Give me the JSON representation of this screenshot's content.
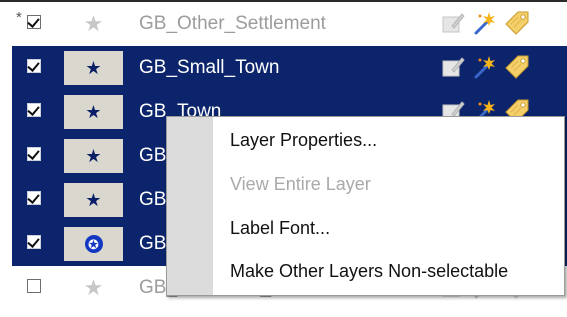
{
  "layers": [
    {
      "name": "GB_Other_Settlement",
      "checked": true,
      "selected": false,
      "asterisk": "*",
      "symbol": "star-gray-icon"
    },
    {
      "name": "GB_Small_Town",
      "checked": true,
      "selected": true,
      "asterisk": "",
      "symbol": "star-navy-icon"
    },
    {
      "name": "GB_Town",
      "checked": true,
      "selected": true,
      "asterisk": "",
      "symbol": "star-navy-icon"
    },
    {
      "name": "GB",
      "checked": true,
      "selected": true,
      "asterisk": "",
      "symbol": "star-navy-icon"
    },
    {
      "name": "GB",
      "checked": true,
      "selected": true,
      "asterisk": "",
      "symbol": "star-navy-icon"
    },
    {
      "name": "GB",
      "checked": true,
      "selected": true,
      "asterisk": "",
      "symbol": "star-badge-icon"
    },
    {
      "name": "GB_Gazetteer_Full",
      "checked": false,
      "selected": false,
      "asterisk": "",
      "symbol": "star-gray-icon"
    }
  ],
  "row_actions": [
    "edit-icon",
    "wand-icon",
    "tag-icon"
  ],
  "context_menu": {
    "items": [
      {
        "label": "Layer Properties...",
        "enabled": true
      },
      {
        "label": "View Entire Layer",
        "enabled": false
      },
      {
        "label": "Label Font...",
        "enabled": true
      },
      {
        "label": "Make Other Layers Non-selectable",
        "enabled": true
      }
    ]
  },
  "colors": {
    "selection": "#0b246b",
    "menu_gutter": "#dcdcdc",
    "disabled_text": "#a9a9a9",
    "star_navy": "#0a1f66",
    "star_gray": "#c8c8c8",
    "badge_blue": "#1437c2"
  }
}
